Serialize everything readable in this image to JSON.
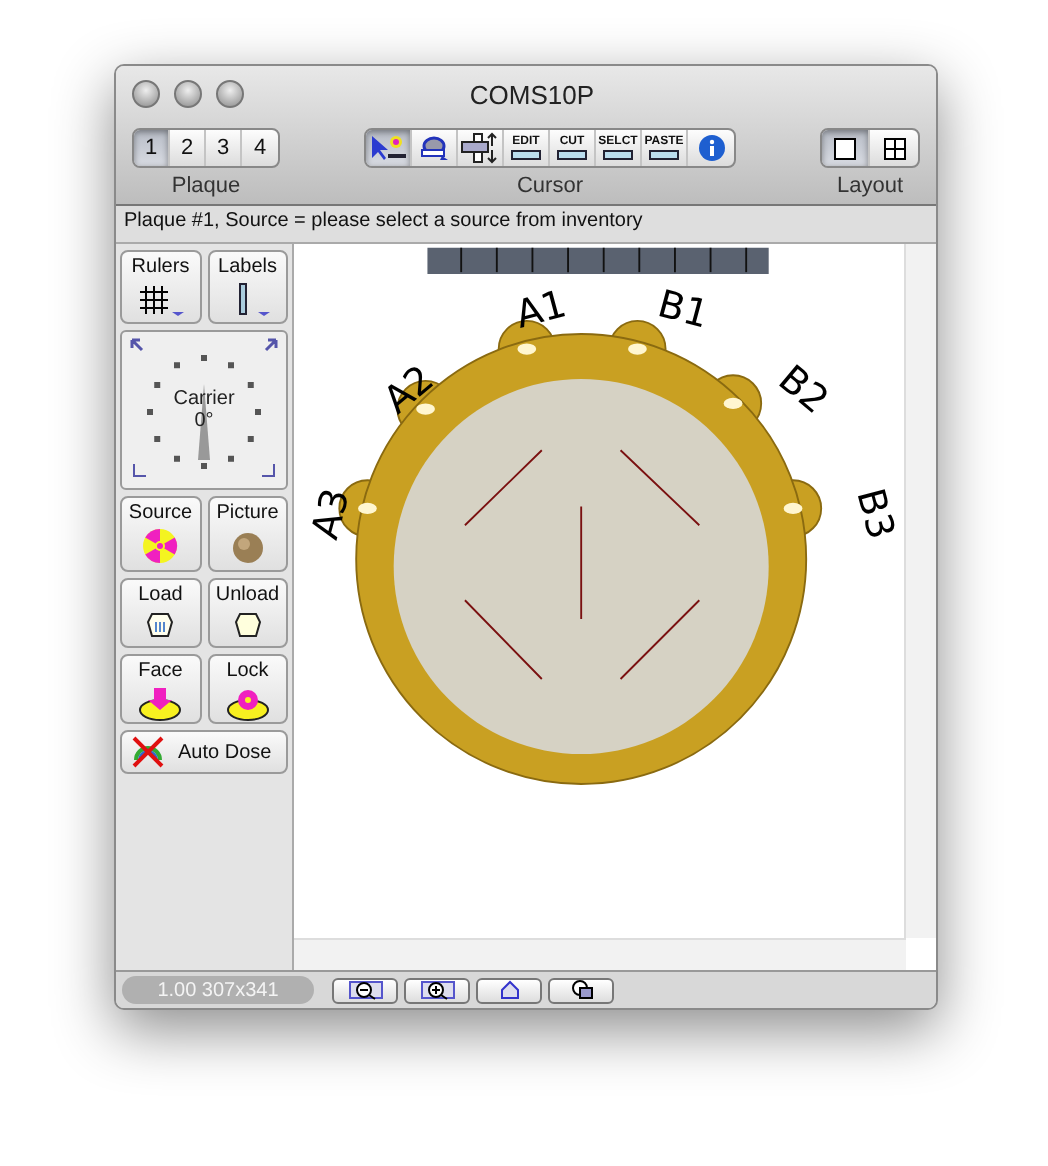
{
  "window": {
    "title": "COMS10P"
  },
  "toolbar": [
    {
      "label": "Plaque",
      "kind": "numbers",
      "items": [
        {
          "label": "1",
          "selected": true
        },
        {
          "label": "2",
          "selected": false
        },
        {
          "label": "3",
          "selected": false
        },
        {
          "label": "4",
          "selected": false
        }
      ]
    },
    {
      "label": "Cursor",
      "kind": "tools",
      "items": [
        {
          "kind": "pointer",
          "selected": true
        },
        {
          "kind": "rotate",
          "selected": false
        },
        {
          "kind": "move",
          "selected": false
        },
        {
          "kind": "word",
          "label": "EDIT",
          "selected": false
        },
        {
          "kind": "word",
          "label": "CUT",
          "selected": false
        },
        {
          "kind": "word",
          "label": "SELCT",
          "selected": false
        },
        {
          "kind": "word",
          "label": "PASTE",
          "selected": false
        },
        {
          "kind": "info",
          "selected": false
        }
      ]
    },
    {
      "label": "Layout",
      "kind": "layout",
      "items": [
        {
          "kind": "single",
          "selected": true
        },
        {
          "kind": "grid",
          "selected": false
        }
      ]
    }
  ],
  "status": "Plaque #1, Source = please select a source from inventory",
  "sidebar": {
    "top": [
      {
        "label": "Rulers",
        "kind": "grid"
      },
      {
        "label": "Labels",
        "kind": "bar"
      }
    ],
    "carrier": {
      "label": "Carrier",
      "angle": "0°"
    },
    "pairs": [
      {
        "label": "Source",
        "kind": "radiation"
      },
      {
        "label": "Picture",
        "kind": "seed"
      },
      {
        "label": "Load",
        "kind": "load"
      },
      {
        "label": "Unload",
        "kind": "unload"
      },
      {
        "label": "Face",
        "kind": "face"
      },
      {
        "label": "Lock",
        "kind": "lock"
      }
    ],
    "auto_dose": {
      "label": "Auto Dose",
      "on": false
    }
  },
  "plaque": {
    "labels": [
      "A1",
      "B1",
      "A2",
      "B2",
      "A3",
      "B3"
    ]
  },
  "bottom": {
    "zoom": "1.00 307x341",
    "buttons": [
      {
        "kind": "zoom-out"
      },
      {
        "kind": "zoom-in"
      },
      {
        "kind": "home"
      },
      {
        "kind": "overlap"
      }
    ]
  }
}
